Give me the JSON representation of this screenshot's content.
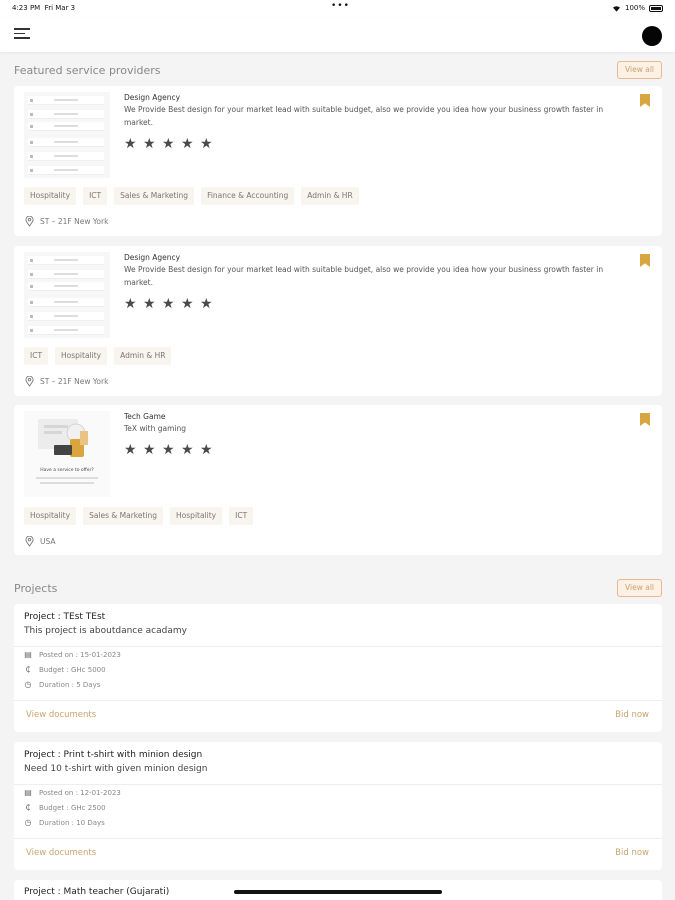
{
  "status_bar": {
    "time": "4:23 PM",
    "date": "Fri Mar 3",
    "dots": "•••",
    "battery": "100%"
  },
  "featured": {
    "title": "Featured service providers",
    "view_all": "View all",
    "providers": [
      {
        "name": "Design Agency",
        "description": "We Provide Best design for your market lead with suitable budget, also we provide you idea how your business growth faster in market.",
        "stars": "★ ★ ★ ★ ★",
        "tags": [
          "Hospitality",
          "ICT",
          "Sales & Marketing",
          "Finance & Accounting",
          "Admin & HR"
        ],
        "location": "ST – 21F New York"
      },
      {
        "name": "Design Agency",
        "description": "We Provide Best design for your market lead with suitable budget, also we provide you idea how your business growth faster in market.",
        "stars": "★ ★ ★ ★ ★",
        "tags": [
          "ICT",
          "Hospitality",
          "Admin & HR"
        ],
        "location": "ST – 21F New York"
      },
      {
        "name": "Tech Game",
        "description": "TeX with gaming",
        "stars": "★ ★ ★ ★ ★",
        "tags": [
          "Hospitality",
          "Sales & Marketing",
          "Hospitality",
          "ICT"
        ],
        "location": "USA",
        "thumb_caption": "Have a service to offer?"
      }
    ]
  },
  "projects": {
    "title": "Projects",
    "view_all": "View all",
    "items": [
      {
        "title": "Project : TEst TEst",
        "description": "This project is aboutdance acadamy",
        "posted": "Posted on : 15-01-2023",
        "budget": "Budget : GHc 5000",
        "duration": "Duration : 5 Days",
        "view_documents": "View documents",
        "bid_now": "Bid now"
      },
      {
        "title": "Project : Print t-shirt with minion design",
        "description": "Need 10 t-shirt with given minion design",
        "posted": "Posted on : 12-01-2023",
        "budget": "Budget : GHc 2500",
        "duration": "Duration : 10 Days",
        "view_documents": "View documents",
        "bid_now": "Bid now"
      },
      {
        "title": "Project : Math teacher (Gujarati)"
      }
    ]
  },
  "colors": {
    "accent": "#c9a46f",
    "bookmark": "#d9a53e",
    "tag_bg": "#f7f5ee"
  },
  "icons": {
    "menu": "hamburger-menu-icon",
    "bookmark": "bookmark-icon",
    "location": "location-pin-icon",
    "calendar": "calendar-icon",
    "currency": "cedi-icon",
    "clock": "clock-icon"
  }
}
